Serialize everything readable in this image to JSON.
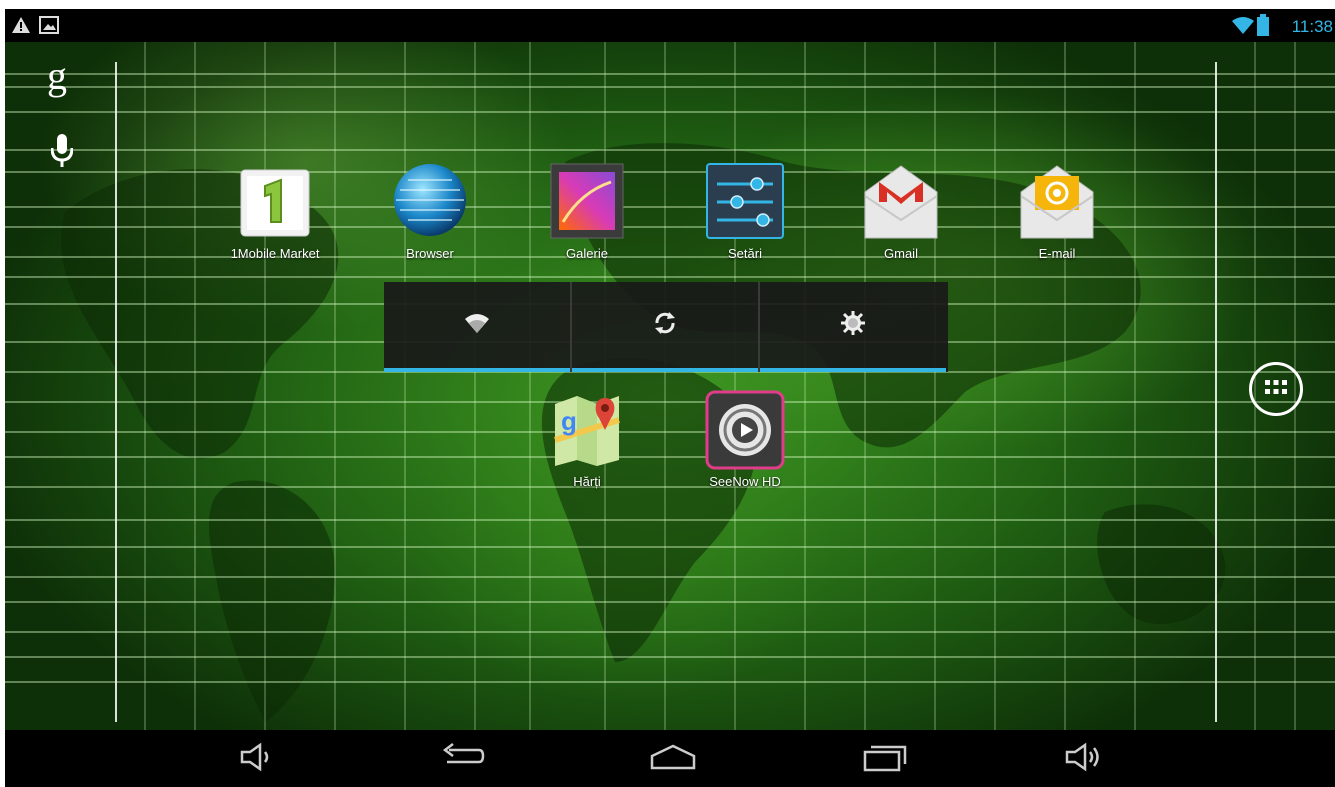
{
  "status_bar": {
    "time": "11:38",
    "left_icons": [
      "warning-icon",
      "image-icon"
    ],
    "right_icons": [
      "wifi-icon",
      "battery-icon"
    ],
    "accent_color": "#33b5e5"
  },
  "side_bar": {
    "search_glyph": "g",
    "icons": [
      "google-search-icon",
      "mic-icon"
    ]
  },
  "apps": [
    {
      "label": "1Mobile Market",
      "icon": "1mobile-market-icon"
    },
    {
      "label": "Browser",
      "icon": "browser-globe-icon"
    },
    {
      "label": "Galerie",
      "icon": "gallery-icon"
    },
    {
      "label": "Setări",
      "icon": "settings-sliders-icon"
    },
    {
      "label": "Gmail",
      "icon": "gmail-icon"
    },
    {
      "label": "E-mail",
      "icon": "email-icon"
    },
    {
      "label": "Hărți",
      "icon": "maps-icon"
    },
    {
      "label": "SeeNow HD",
      "icon": "seenow-hd-icon"
    }
  ],
  "power_widget": {
    "buttons": [
      "wifi-toggle",
      "sync-toggle",
      "brightness-toggle"
    ]
  },
  "nav_bar": {
    "buttons": [
      "volume-down",
      "back",
      "home",
      "recent-apps",
      "volume-up"
    ]
  }
}
